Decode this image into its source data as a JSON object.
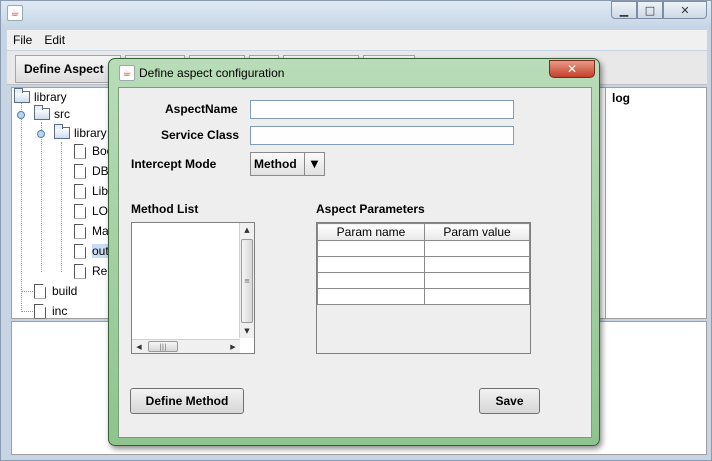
{
  "app": {
    "menu": [
      "File",
      "Edit"
    ],
    "toolbar_first_tab": "Define Aspect",
    "log_label": "log"
  },
  "tree": {
    "root": "library",
    "src": "src",
    "library_pkg": "library",
    "files": [
      "Boo",
      "DB",
      "Lib",
      "LO",
      "Ma",
      "out",
      "Re"
    ],
    "build": "build",
    "inc": "inc"
  },
  "dialog": {
    "title": "Define aspect configuration",
    "aspect_name_label": "AspectName",
    "aspect_name_value": "",
    "service_class_label": "Service Class",
    "service_class_value": "",
    "intercept_mode_label": "Intercept Mode",
    "intercept_mode_value": "Method",
    "method_list_label": "Method List",
    "aspect_params_label": "Aspect Parameters",
    "param_columns": [
      "Param name",
      "Param value"
    ],
    "define_method_button": "Define Method",
    "save_button": "Save"
  },
  "colors": {
    "dialog_frame": "#8ec48d",
    "close_button": "#c4402b",
    "selection": "#c9dcf5"
  },
  "icons": [
    "java-cup-icon",
    "minimize-icon",
    "maximize-icon",
    "close-icon",
    "folder-icon",
    "file-icon",
    "dropdown-arrow-icon"
  ]
}
